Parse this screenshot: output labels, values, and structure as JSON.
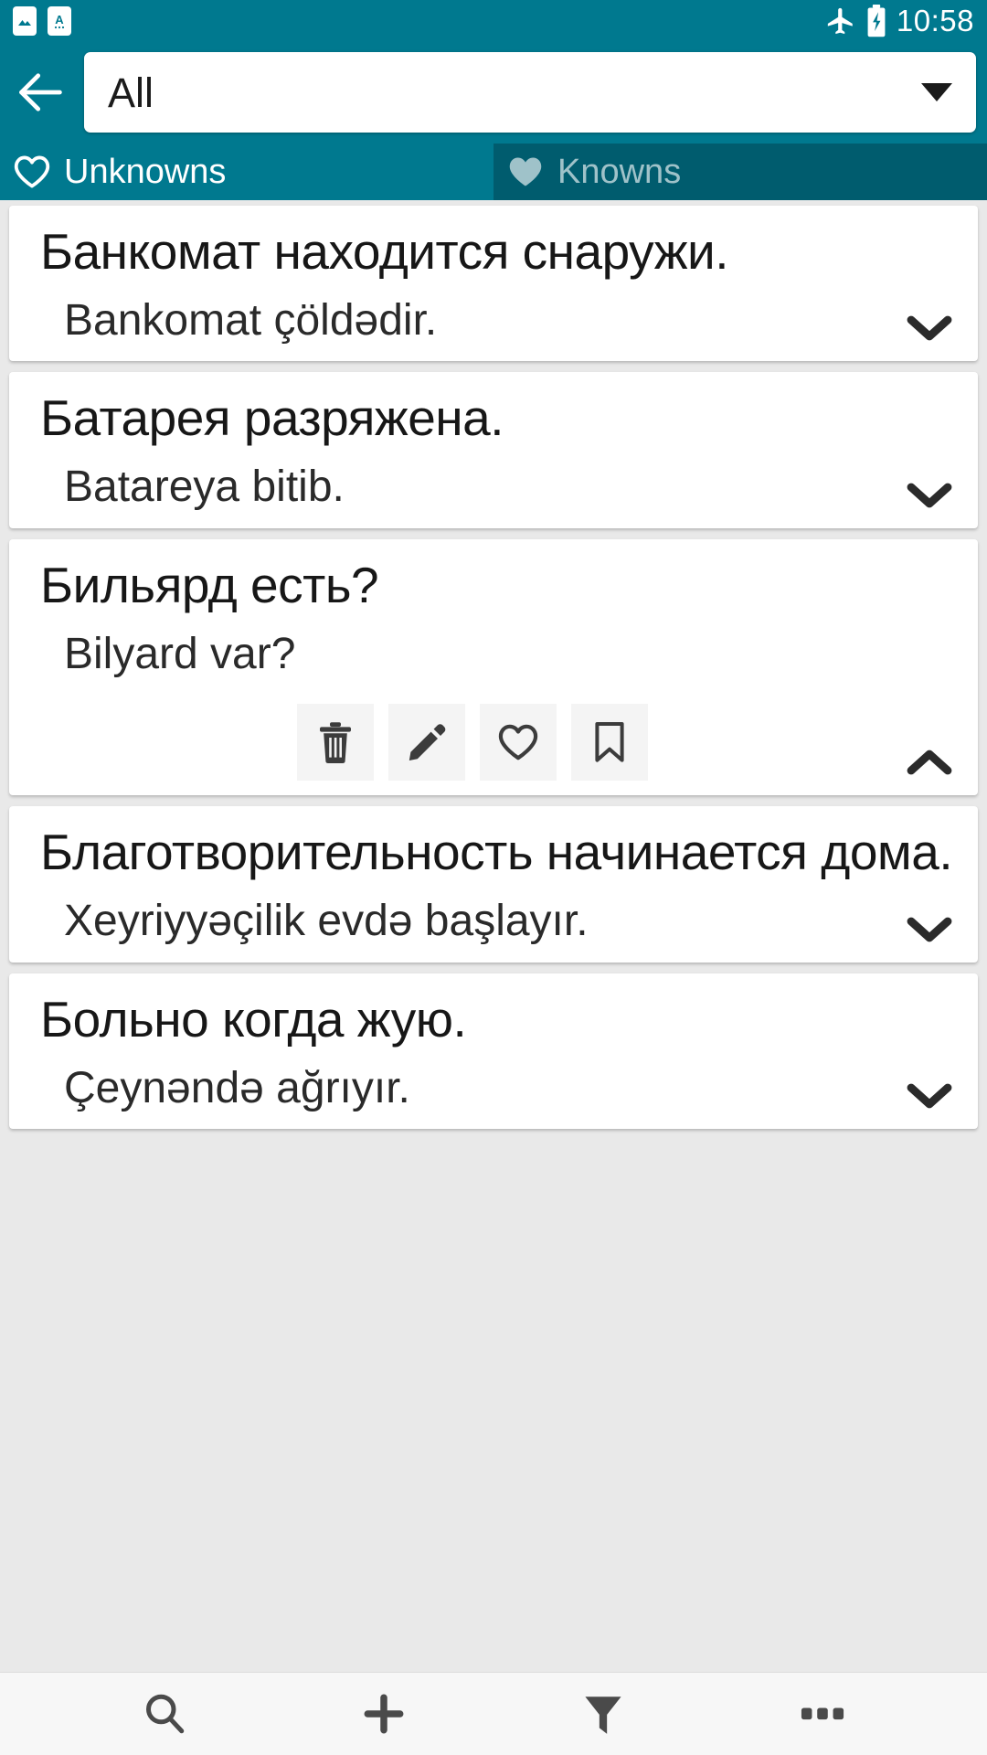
{
  "status_bar": {
    "time": "10:58",
    "icons": [
      "image-notification-icon",
      "translate-notification-icon",
      "airplane-mode-icon",
      "battery-charging-icon"
    ]
  },
  "toolbar": {
    "back_icon": "back-arrow-icon",
    "filter_selected": "All",
    "dropdown_icon": "chevron-down-icon"
  },
  "tabs": [
    {
      "label": "Unknowns",
      "icon": "heart-outline-icon",
      "active": true
    },
    {
      "label": "Knowns",
      "icon": "heart-filled-icon",
      "active": false
    }
  ],
  "cards": [
    {
      "term": "Банкомат находится снаружи.",
      "definition": "Bankomat çöldədir.",
      "expanded": false,
      "toggle_icon": "chevron-down-icon"
    },
    {
      "term": "Батарея разряжена.",
      "definition": "Batareya bitib.",
      "expanded": false,
      "toggle_icon": "chevron-down-icon"
    },
    {
      "term": "Бильярд есть?",
      "definition": "Bilyard var?",
      "expanded": true,
      "toggle_icon": "chevron-up-icon",
      "actions": [
        "delete-icon",
        "edit-icon",
        "favorite-icon",
        "bookmark-icon"
      ]
    },
    {
      "term": "Благотворительность начинается дома.",
      "definition": "Xeyriyyəçilik evdə başlayır.",
      "expanded": false,
      "toggle_icon": "chevron-down-icon"
    },
    {
      "term": "Больно когда жую.",
      "definition": "Çeynəndə ağrıyır.",
      "expanded": false,
      "toggle_icon": "chevron-down-icon"
    }
  ],
  "bottom_bar": [
    {
      "icon": "search-icon",
      "name": "search"
    },
    {
      "icon": "add-icon",
      "name": "add"
    },
    {
      "icon": "filter-icon",
      "name": "filter"
    },
    {
      "icon": "overflow-icon",
      "name": "more"
    }
  ],
  "colors": {
    "primary": "#00798f",
    "primary_dark": "#005c6e",
    "background": "#e9e9e9",
    "card": "#ffffff",
    "text": "#171717",
    "inactive_tab_text": "#9fc2c9"
  }
}
